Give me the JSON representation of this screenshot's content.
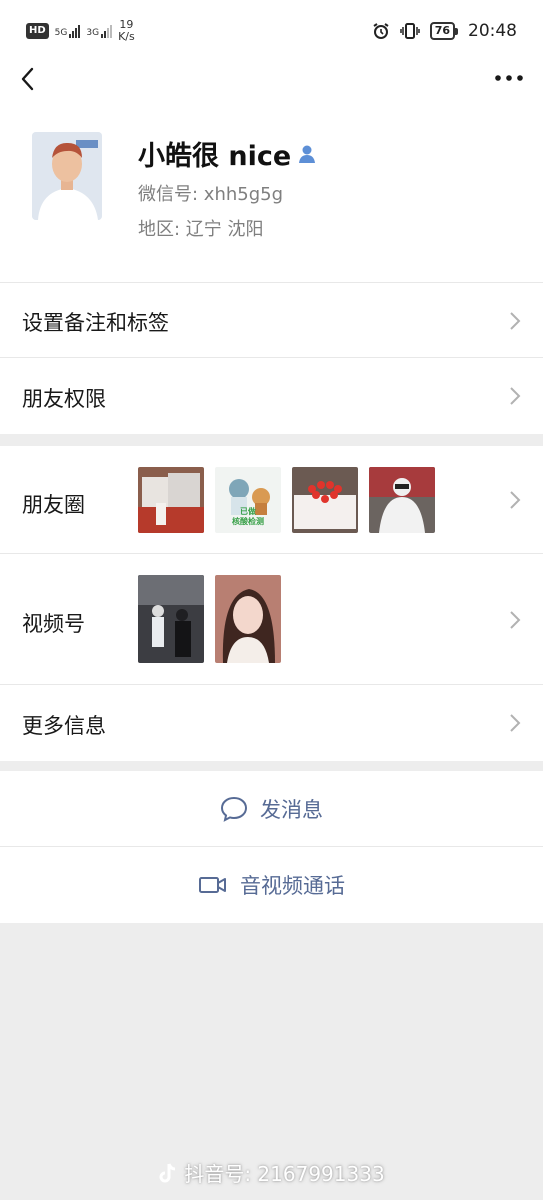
{
  "status_bar": {
    "hd": "HD",
    "net1": "5G",
    "net2": "3G",
    "speed_value": "19",
    "speed_unit": "K/s",
    "battery": "76",
    "time": "20:48"
  },
  "profile": {
    "nickname": "小皓很 nice",
    "wechat_id": "微信号:  xhh5g5g",
    "region": "地区:  辽宁  沈阳"
  },
  "menu_top": [
    {
      "label": "设置备注和标签"
    },
    {
      "label": "朋友权限"
    }
  ],
  "menu_media": {
    "moments_label": "朋友圈",
    "moments_sticker_text": "已做\n核酸检测",
    "channels_label": "视频号",
    "more_info_label": "更多信息"
  },
  "actions": {
    "message_label": "发消息",
    "call_label": "音视频通话"
  },
  "watermark": "抖音号: 2167991333",
  "colors": {
    "link_blue": "#576b95",
    "background": "#ededed"
  }
}
